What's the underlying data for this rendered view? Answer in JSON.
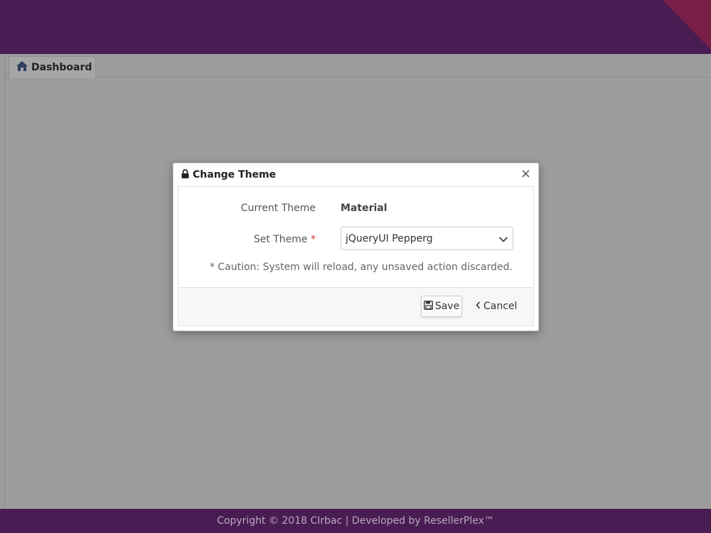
{
  "colors": {
    "topbar": "#4a1c54",
    "accent_corner": "#7a1f47",
    "overlay": "#9c9c9c",
    "required": "#d0312d"
  },
  "tab": {
    "label": "Dashboard",
    "icon": "home-icon"
  },
  "dialog": {
    "title": "Change Theme",
    "title_icon": "lock-icon",
    "close_label": "×",
    "current_theme_label": "Current Theme",
    "current_theme_value": "Material",
    "set_theme_label": "Set Theme",
    "required_mark": "*",
    "selected_theme": "jQueryUI Pepperg",
    "caution": "* Caution: System will reload, any unsaved action discarded.",
    "save_label": "Save",
    "cancel_label": "Cancel"
  },
  "footer": {
    "text": "Copyright © 2018 CIrbac | Developed by ResellerPlex™"
  }
}
